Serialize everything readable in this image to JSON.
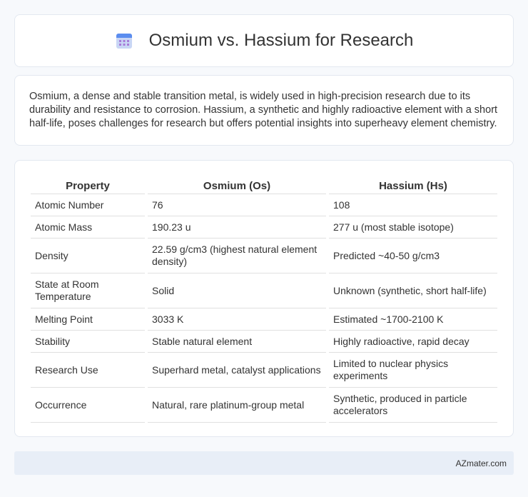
{
  "header": {
    "title": "Osmium vs. Hassium for Research",
    "icon": "calendar-icon"
  },
  "intro": {
    "text": "Osmium, a dense and stable transition metal, is widely used in high-precision research due to its durability and resistance to corrosion. Hassium, a synthetic and highly radioactive element with a short half-life, poses challenges for research but offers potential insights into superheavy element chemistry."
  },
  "table": {
    "headers": [
      "Property",
      "Osmium (Os)",
      "Hassium (Hs)"
    ],
    "rows": [
      [
        "Atomic Number",
        "76",
        "108"
      ],
      [
        "Atomic Mass",
        "190.23 u",
        "277 u (most stable isotope)"
      ],
      [
        "Density",
        "22.59 g/cm3 (highest natural element density)",
        "Predicted ~40-50 g/cm3"
      ],
      [
        "State at Room Temperature",
        "Solid",
        "Unknown (synthetic, short half-life)"
      ],
      [
        "Melting Point",
        "3033 K",
        "Estimated ~1700-2100 K"
      ],
      [
        "Stability",
        "Stable natural element",
        "Highly radioactive, rapid decay"
      ],
      [
        "Research Use",
        "Superhard metal, catalyst applications",
        "Limited to nuclear physics experiments"
      ],
      [
        "Occurrence",
        "Natural, rare platinum-group metal",
        "Synthetic, produced in particle accelerators"
      ]
    ]
  },
  "footer": {
    "text": "AZmater.com"
  }
}
